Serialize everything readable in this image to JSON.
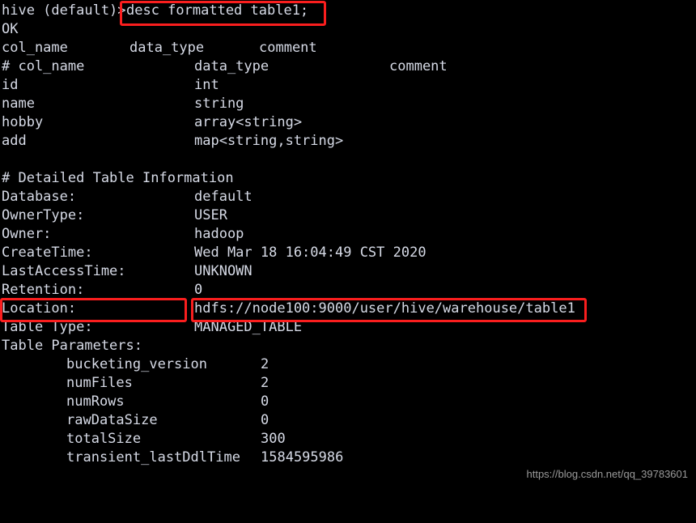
{
  "terminal": {
    "background_color": "#000000",
    "text_color": "#d6dae6",
    "highlight_color": "#fa1e1e",
    "top_clipped_line": "                                                     ",
    "prompt": "hive (default)>",
    "command": "desc formatted table1;",
    "status_ok": "OK",
    "header_row": {
      "col_name": "col_name",
      "data_type": "data_type",
      "comment": "comment"
    },
    "schema_header": {
      "col_name": "# col_name",
      "data_type": "data_type",
      "comment": "comment"
    },
    "columns": [
      {
        "name": "id",
        "type": "int",
        "comment": ""
      },
      {
        "name": "name",
        "type": "string",
        "comment": ""
      },
      {
        "name": "hobby",
        "type": "array<string>",
        "comment": ""
      },
      {
        "name": "add",
        "type": "map<string,string>",
        "comment": ""
      }
    ],
    "detailed_section_title": "# Detailed Table Information",
    "details": [
      {
        "key": "Database:",
        "value": "default"
      },
      {
        "key": "OwnerType:",
        "value": "USER"
      },
      {
        "key": "Owner:",
        "value": "hadoop"
      },
      {
        "key": "CreateTime:",
        "value": "Wed Mar 18 16:04:49 CST 2020"
      },
      {
        "key": "LastAccessTime:",
        "value": "UNKNOWN"
      },
      {
        "key": "Retention:",
        "value": "0"
      }
    ],
    "location": {
      "key": "Location:",
      "value": "hdfs://node100:9000/user/hive/warehouse/table1"
    },
    "table_type": {
      "key": "Table Type:",
      "value": "MANAGED_TABLE"
    },
    "table_parameters_title": "Table Parameters:",
    "table_parameters": [
      {
        "key": "bucketing_version",
        "value": "2"
      },
      {
        "key": "numFiles",
        "value": "2"
      },
      {
        "key": "numRows",
        "value": "0"
      },
      {
        "key": "rawDataSize",
        "value": "0"
      },
      {
        "key": "totalSize",
        "value": "300"
      },
      {
        "key": "transient_lastDdlTime",
        "value": "1584595986"
      }
    ]
  },
  "watermark": "https://blog.csdn.net/qq_39783601"
}
